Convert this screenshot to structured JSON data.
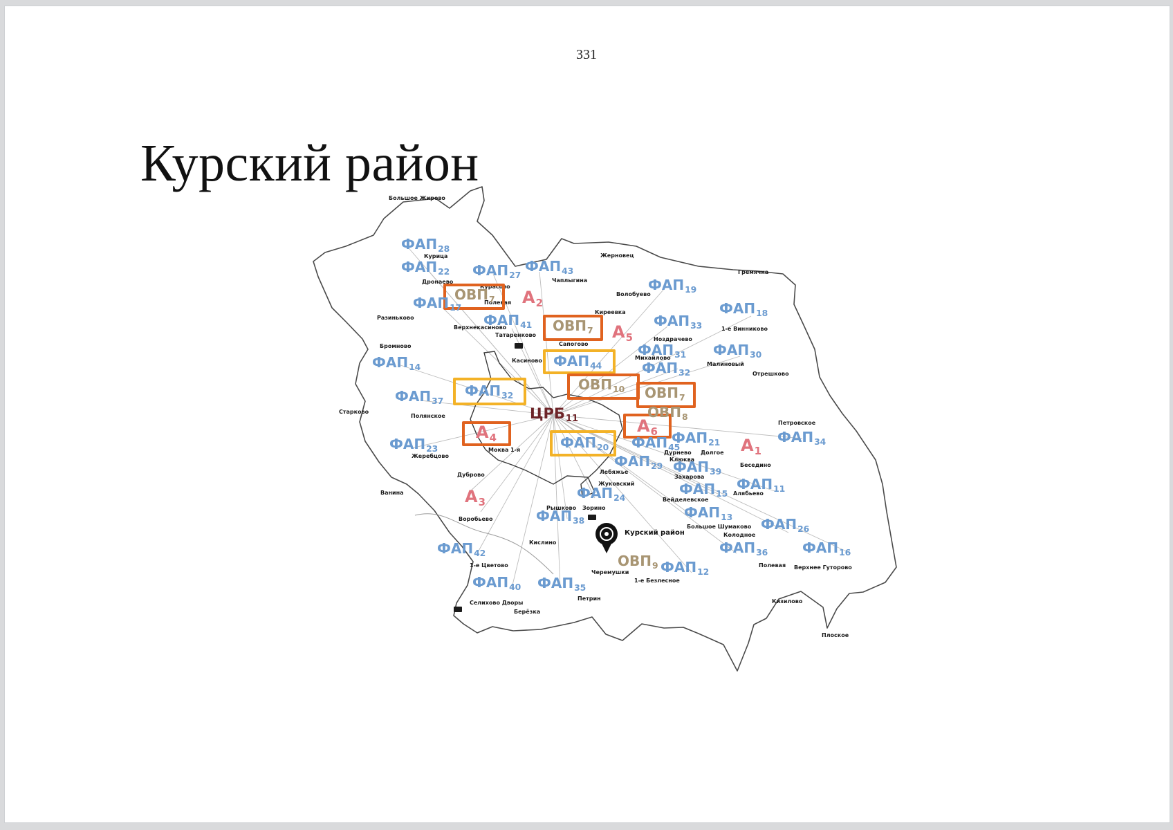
{
  "page": {
    "number": "331",
    "title": "Курский район"
  },
  "colors": {
    "fap": "#6b9bd0",
    "ovp": "#a89573",
    "ambulatory": "#e0737d",
    "central_hospital": "#6d2428",
    "box_orange": "#e0621f",
    "box_yellow": "#f3b227"
  },
  "map": {
    "central_hospital": {
      "text": "ЦРБ",
      "index": "11"
    },
    "pin": {
      "icon": "map-pin-icon",
      "label": "Курский район"
    },
    "fap": [
      {
        "text": "ФАП",
        "index": "28"
      },
      {
        "text": "ФАП",
        "index": "22"
      },
      {
        "text": "ФАП",
        "index": "27"
      },
      {
        "text": "ФАП",
        "index": "43"
      },
      {
        "text": "ФАП",
        "index": "19"
      },
      {
        "text": "ФАП",
        "index": "17"
      },
      {
        "text": "ФАП",
        "index": "18"
      },
      {
        "text": "ФАП",
        "index": "41"
      },
      {
        "text": "ФАП",
        "index": "33"
      },
      {
        "text": "ФАП",
        "index": "31"
      },
      {
        "text": "ФАП",
        "index": "30"
      },
      {
        "text": "ФАП",
        "index": "14"
      },
      {
        "text": "ФАП",
        "index": "44"
      },
      {
        "text": "ФАП",
        "index": "32"
      },
      {
        "text": "ФАП",
        "index": "32"
      },
      {
        "text": "ФАП",
        "index": "37"
      },
      {
        "text": "ФАП",
        "index": "21"
      },
      {
        "text": "ФАП",
        "index": "34"
      },
      {
        "text": "ФАП",
        "index": "23"
      },
      {
        "text": "ФАП",
        "index": "20"
      },
      {
        "text": "ФАП",
        "index": "45"
      },
      {
        "text": "ФАП",
        "index": "29"
      },
      {
        "text": "ФАП",
        "index": "39"
      },
      {
        "text": "ФАП",
        "index": "15"
      },
      {
        "text": "ФАП",
        "index": "11"
      },
      {
        "text": "ФАП",
        "index": "24"
      },
      {
        "text": "ФАП",
        "index": "13"
      },
      {
        "text": "ФАП",
        "index": "38"
      },
      {
        "text": "ФАП",
        "index": "26"
      },
      {
        "text": "ФАП",
        "index": "42"
      },
      {
        "text": "ФАП",
        "index": "36"
      },
      {
        "text": "ФАП",
        "index": "16"
      },
      {
        "text": "ФАП",
        "index": "12"
      },
      {
        "text": "ФАП",
        "index": "40"
      },
      {
        "text": "ФАП",
        "index": "35"
      }
    ],
    "ovp": [
      {
        "text": "ОВП",
        "index": "7"
      },
      {
        "text": "ОВП",
        "index": "7"
      },
      {
        "text": "ОВП",
        "index": "10"
      },
      {
        "text": "ОВП",
        "index": "7"
      },
      {
        "text": "ОВП",
        "index": "8"
      },
      {
        "text": "ОВП",
        "index": "9"
      }
    ],
    "ambulatories": [
      {
        "text": "А",
        "index": "2"
      },
      {
        "text": "А",
        "index": "5"
      },
      {
        "text": "А",
        "index": "4"
      },
      {
        "text": "А",
        "index": "6"
      },
      {
        "text": "А",
        "index": "1"
      },
      {
        "text": "А",
        "index": "3"
      }
    ],
    "villages": [
      "Большое Жирово",
      "Курица",
      "Дронаево",
      "Курасово",
      "Разиньково",
      "Верхнекасиново",
      "Татаренково",
      "Полевая",
      "Бромново",
      "Касиново",
      "Сапогово",
      "Жерновец",
      "Чаплыгина",
      "Волобуево",
      "Гремячка",
      "Киреевка",
      "1-е Винниково",
      "Ноздрачево",
      "Малиновый",
      "Отрешково",
      "Михайлово",
      "Старково",
      "Полянское",
      "Петровское",
      "Жеребцово",
      "Моква 1-я",
      "Дуброво",
      "Дурнево",
      "Долгое",
      "Клюква",
      "Бесединo",
      "Ванина",
      "Лебяжье",
      "Захарова",
      "Алябьево",
      "Вейделевское",
      "Рышково",
      "Зорино",
      "Большое Шумаково",
      "Колодное",
      "Воробьево",
      "Кислино",
      "1-е Цветово",
      "Черемушки",
      "1-е Безлесное",
      "Полевая",
      "Верхнее Гуторово",
      "Селихово Дворы",
      "Петрин",
      "Берёзка",
      "Кизилово",
      "Плоское",
      "Жуковский"
    ]
  }
}
